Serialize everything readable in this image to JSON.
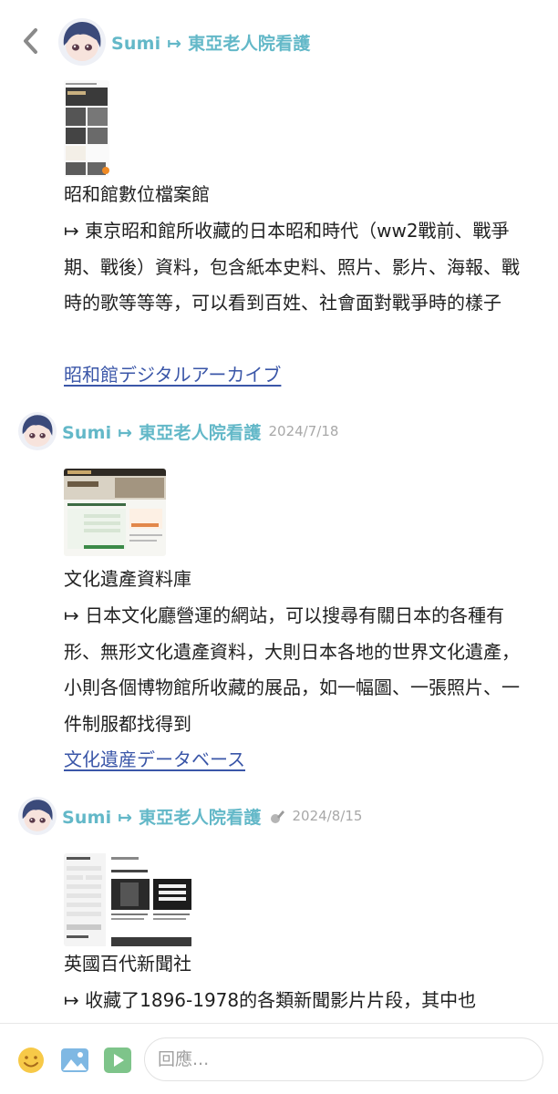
{
  "nav": {
    "back_icon": "chevron-left-icon"
  },
  "posts": [
    {
      "author": "Sumi",
      "author_suffix": "↦ 東亞老人院看護",
      "date": "",
      "title": "昭和館數位檔案館",
      "description": "↦ 東京昭和館所收藏的日本昭和時代（ww2戰前、戰爭期、戰後）資料，包含紙本史料、照片、影片、海報、戰時的歌等等等，可以看到百姓、社會面對戰爭時的樣子",
      "link": "昭和館デジタルアーカイブ"
    },
    {
      "author": "Sumi",
      "author_suffix": "↦ 東亞老人院看護",
      "date": "2024/7/18",
      "title": "文化遺產資料庫",
      "description": "↦ 日本文化廳營運的網站，可以搜尋有關日本的各種有形、無形文化遺產資料，大則日本各地的世界文化遺產，小則各個博物館所收藏的展品，如一幅圖、一張照片、一件制服都找得到",
      "link": "文化遺産データベース"
    },
    {
      "author": "Sumi",
      "author_suffix": "↦ 東亞老人院看護",
      "date": "2024/8/15",
      "title": "英國百代新聞社",
      "description": "↦ 收藏了1896-1978的各類新聞影片片段，其中也"
    }
  ],
  "composer": {
    "placeholder": "回應...",
    "icons": [
      "emoji-icon",
      "image-icon",
      "video-icon"
    ]
  },
  "colors": {
    "username": "#63b8c8",
    "link": "#3a56a8",
    "date": "#a8a8a8"
  }
}
